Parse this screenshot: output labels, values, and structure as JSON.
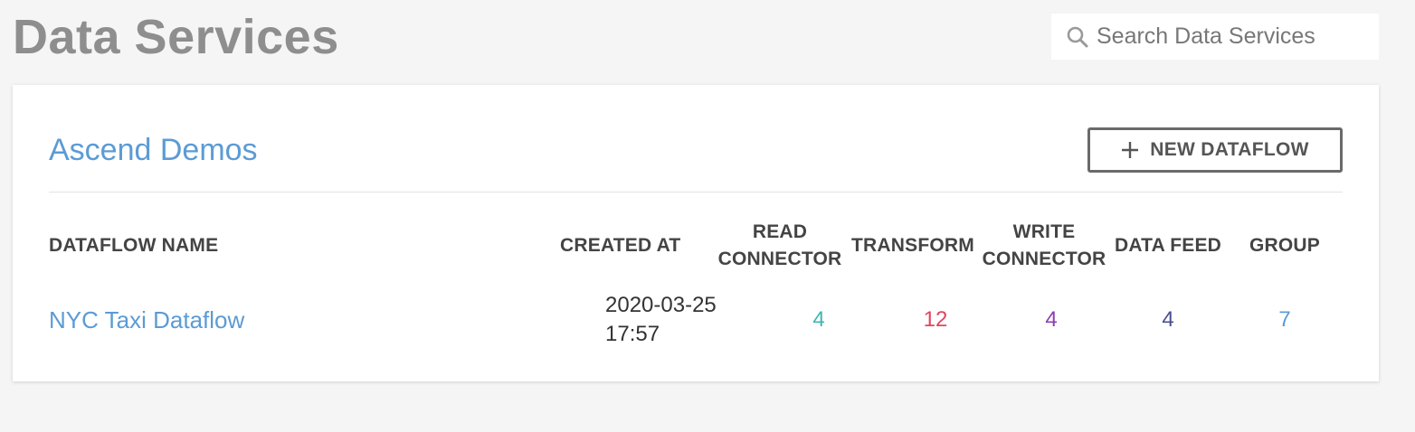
{
  "page": {
    "title": "Data Services"
  },
  "search": {
    "placeholder": "Search Data Services",
    "value": ""
  },
  "group": {
    "title": "Ascend Demos",
    "new_dataflow_label": "NEW DATAFLOW"
  },
  "table": {
    "columns": {
      "name": "DATAFLOW NAME",
      "created_at": "CREATED AT",
      "read_connector_1": "READ",
      "read_connector_2": "CONNECTOR",
      "transform": "TRANSFORM",
      "write_connector_1": "WRITE",
      "write_connector_2": "CONNECTOR",
      "data_feed": "DATA FEED",
      "group": "GROUP"
    },
    "rows": [
      {
        "name": "NYC Taxi Dataflow",
        "created_date": "2020-03-25",
        "created_time": "17:57",
        "read_connector": "4",
        "transform": "12",
        "write_connector": "4",
        "data_feed": "4",
        "group": "7"
      }
    ]
  },
  "colors": {
    "title_gray": "#8e8e8e",
    "link_blue": "#5b9bd5",
    "read_connector": "#3fb7ae",
    "transform": "#e2455e",
    "write_connector": "#8d3fb0",
    "data_feed": "#4a4f8f",
    "group": "#5b9bd5"
  },
  "icons": {
    "search": "search-icon",
    "plus": "plus-icon"
  }
}
